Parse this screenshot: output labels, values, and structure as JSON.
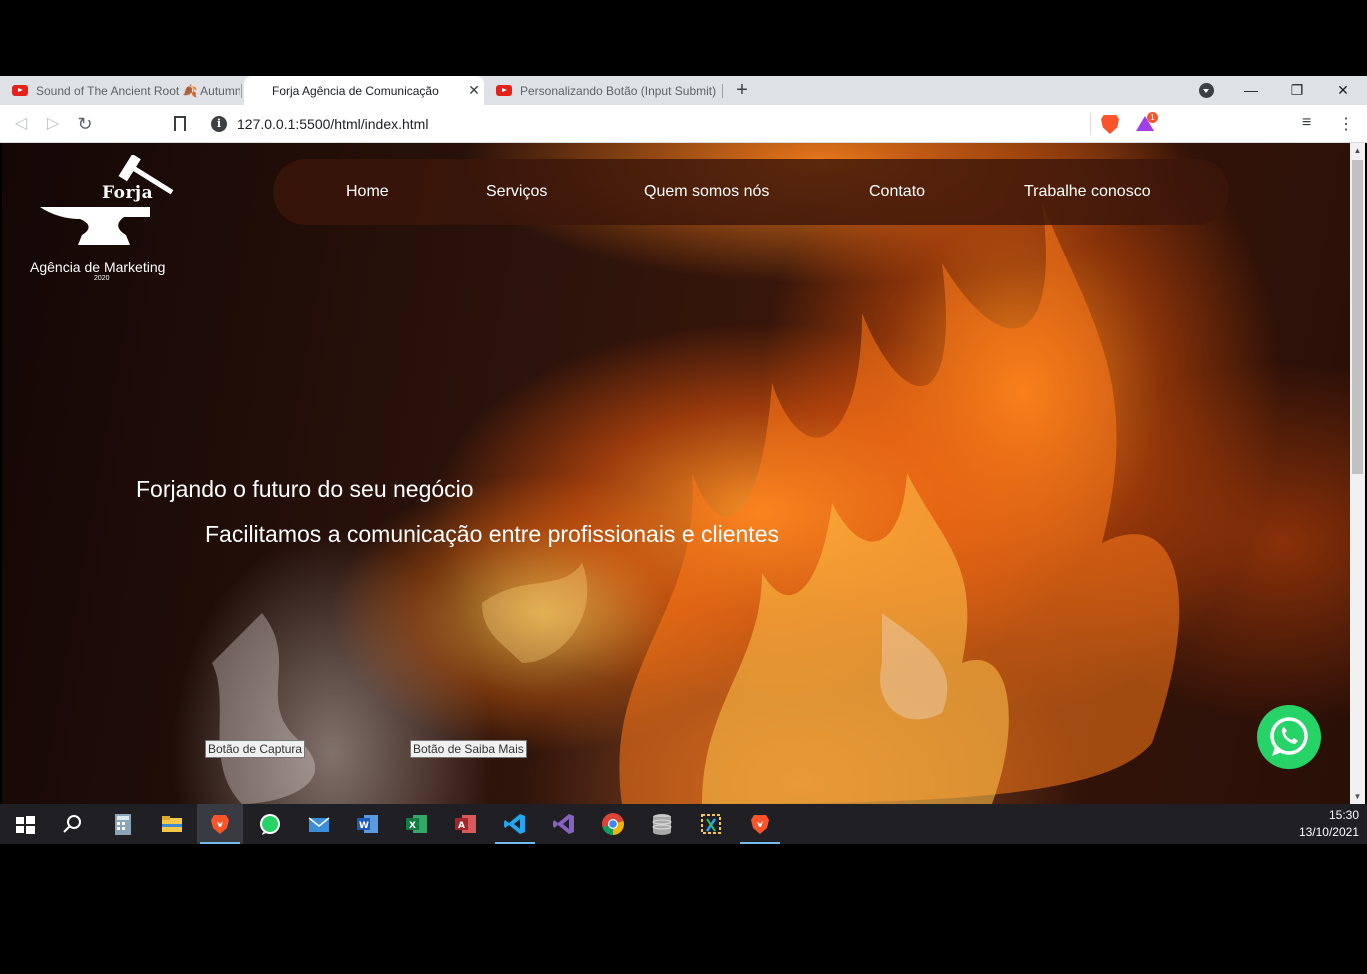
{
  "browser": {
    "tabs": [
      {
        "label": "Sound of The Ancient Root 🍂 Autumn",
        "active": false,
        "favicon": "youtube-icon"
      },
      {
        "label": "Forja Agência de Comunicação",
        "active": true,
        "favicon": "page-icon"
      },
      {
        "label": "Personalizando Botão (Input Submit) | ",
        "active": false,
        "favicon": "youtube-icon"
      }
    ],
    "close_glyph": "✕",
    "new_tab_glyph": "+",
    "url": "127.0.0.1:5500/html/index.html",
    "rewards_badge": "1",
    "accent_color": "#fb542b"
  },
  "site": {
    "logo": {
      "brand": "Forja",
      "tagline": "Agência de Marketing",
      "year": "2020"
    },
    "nav": [
      "Home",
      "Serviços",
      "Quem somos nós",
      "Contato",
      "Trabalhe conosco"
    ],
    "hero": {
      "title": "Forjando o futuro do seu negócio",
      "subtitle": "Facilitamos a comunicação entre profissionais e clientes"
    },
    "buttons": {
      "capture": "Botão de Captura",
      "learn_more": "Botão de Saiba Mais"
    },
    "whatsapp_color": "#25d366"
  },
  "taskbar": {
    "time": "15:30",
    "date": "13/10/2021",
    "apps": [
      "windows-start-icon",
      "search-icon",
      "calculator-icon",
      "file-explorer-icon",
      "brave-icon",
      "whatsapp-icon",
      "mail-icon",
      "word-icon",
      "excel-icon",
      "access-icon",
      "vscode-icon",
      "visual-studio-icon",
      "chrome-icon",
      "database-icon",
      "snipping-tool-icon",
      "brave-icon"
    ]
  }
}
